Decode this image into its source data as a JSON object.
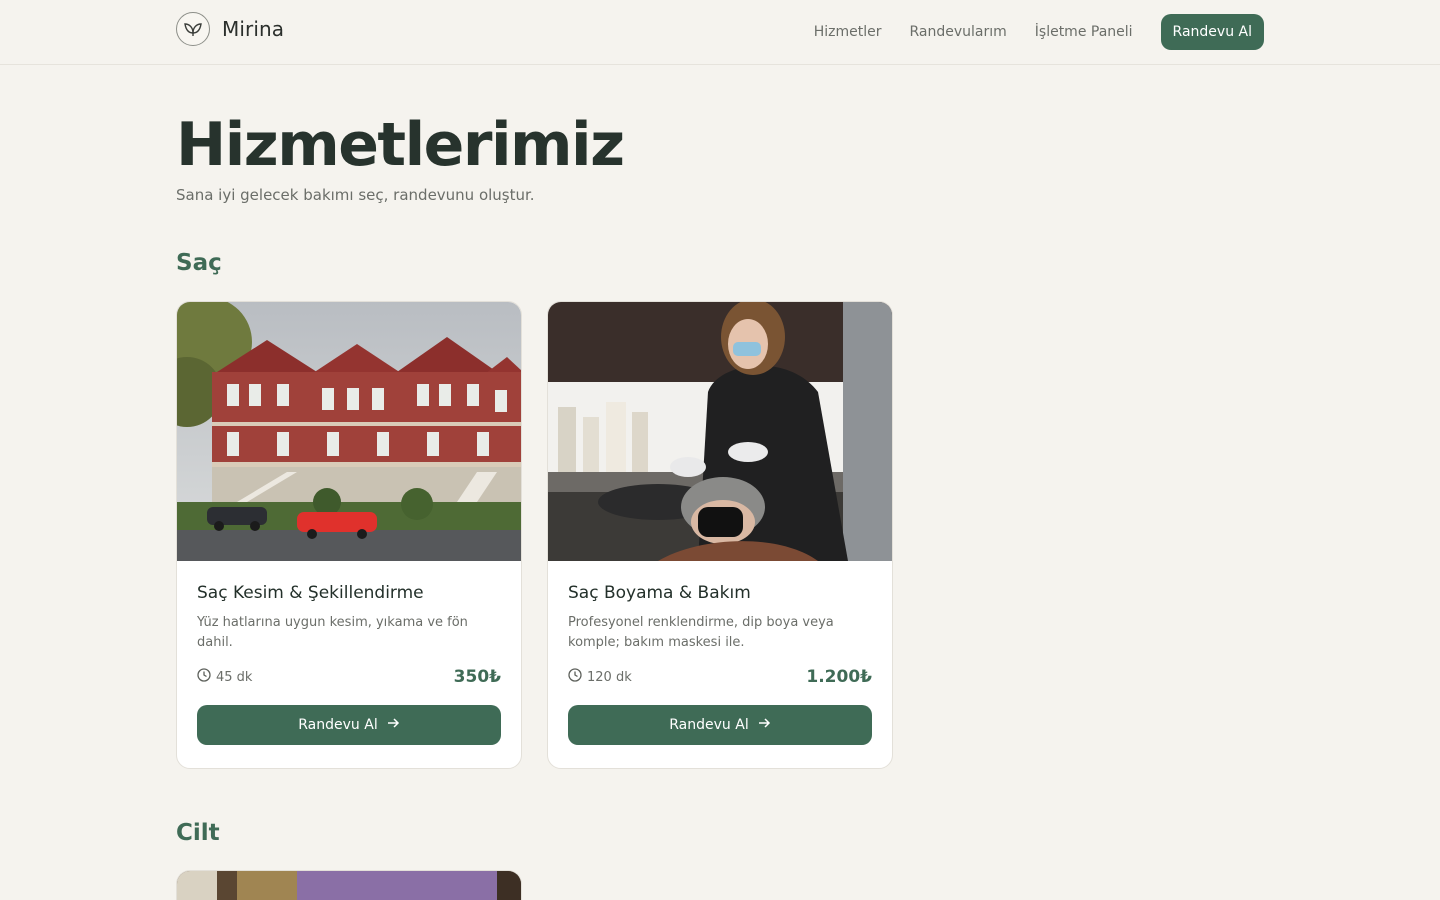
{
  "brand": {
    "name": "Mirina",
    "logo_icon": "leaf-logo-icon"
  },
  "nav": {
    "links": [
      "Hizmetler",
      "Randevularım",
      "İşletme Paneli"
    ],
    "cta_label": "Randevu Al"
  },
  "hero": {
    "title": "Hizmetlerimiz",
    "subtitle": "Sana iyi gelecek bakımı seç, randevunu oluştur."
  },
  "sections": [
    {
      "title": "Saç",
      "services": [
        {
          "title": "Saç Kesim & Şekillendirme",
          "description": "Yüz hatlarına uygun kesim, yıkama ve fön dahil.",
          "duration": "45 dk",
          "price": "350₺",
          "button_label": "Randevu Al",
          "image": "photo-red-victorian-houses"
        },
        {
          "title": "Saç Boyama & Bakım",
          "description": "Profesyonel renklendirme, dip boya veya komple; bakım maskesi ile.",
          "duration": "120 dk",
          "price": "1.200₺",
          "button_label": "Randevu Al",
          "image": "photo-hair-salon-washing"
        }
      ]
    },
    {
      "title": "Cilt",
      "services": [
        {
          "image": "photo-skincare-products"
        }
      ]
    }
  ],
  "colors": {
    "background": "#f5f3ee",
    "accent": "#3f6b56",
    "text": "#27332d",
    "muted": "#6b6e69"
  }
}
